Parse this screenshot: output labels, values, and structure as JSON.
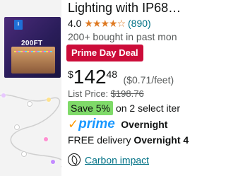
{
  "product": {
    "title": "Lighting with IP68…",
    "box_label": "200FT",
    "rating_value": "4.0",
    "stars": "★★★★☆",
    "rating_count": "(890)",
    "bought": "200+ bought in past mon",
    "deal_badge": "Prime Day Deal",
    "price": {
      "currency": "$",
      "whole": "142",
      "fraction": "48",
      "unit": "($0.71/feet)"
    },
    "list_price": {
      "label": "List Price:",
      "value": "$198.76"
    },
    "save": {
      "badge": "Save 5%",
      "text": "on 2 select iter"
    },
    "prime": {
      "check": "✓",
      "word": "prime",
      "speed": "Overnight"
    },
    "delivery": {
      "prefix": "FREE delivery",
      "bold": "Overnight 4"
    },
    "carbon": {
      "icon": "leaf-icon",
      "label": "Carbon impact"
    }
  },
  "colors": {
    "deal_red": "#cc0c39",
    "star_orange": "#de7921",
    "link_teal": "#007185",
    "save_green": "#7fda69",
    "prime_blue": "#1a98ff",
    "prime_check": "#ff9900"
  }
}
